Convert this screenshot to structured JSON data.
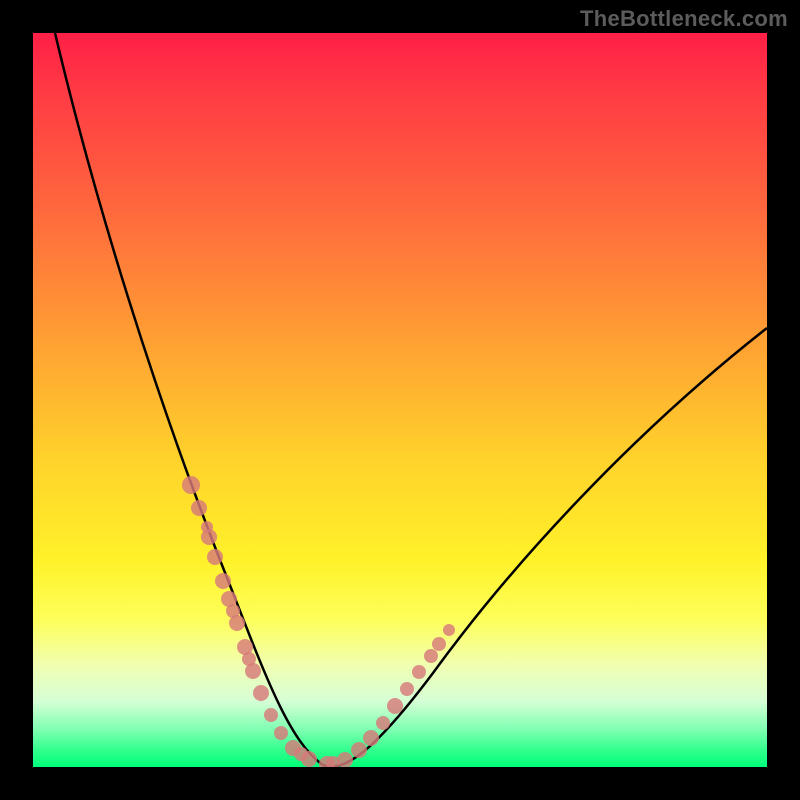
{
  "watermark_text": "TheBottleneck.com",
  "colors": {
    "background": "#000000",
    "curve": "#000000",
    "marker": "#d77a7a",
    "gradient_top": "#ff1f47",
    "gradient_bottom": "#00ff78"
  },
  "chart_data": {
    "type": "line",
    "title": "",
    "xlabel": "",
    "ylabel": "",
    "xlim": [
      0,
      100
    ],
    "ylim": [
      0,
      100
    ],
    "grid": false,
    "legend": false,
    "series": [
      {
        "name": "curve",
        "x": [
          3,
          6,
          9,
          12,
          15,
          18,
          21,
          24,
          27,
          28,
          30,
          33,
          36,
          40,
          44,
          48,
          54,
          60,
          68,
          76,
          84,
          92,
          100
        ],
        "y": [
          100,
          86,
          74,
          64,
          55,
          47,
          40,
          32,
          24,
          20,
          14,
          8,
          3,
          0,
          2,
          6,
          12,
          20,
          29,
          38,
          46,
          53,
          60
        ]
      },
      {
        "name": "markers",
        "type": "scatter",
        "x": [
          21,
          22,
          24,
          25,
          26,
          27,
          28,
          29,
          30,
          31,
          33,
          34,
          36,
          38,
          40,
          42,
          44,
          45,
          47,
          48,
          50,
          52
        ],
        "y": [
          40,
          37,
          32,
          28,
          25,
          22,
          20,
          17,
          14,
          11,
          8,
          6,
          3,
          1,
          0,
          1,
          2,
          3,
          5,
          7,
          10,
          13
        ]
      }
    ],
    "note": "Axes have no numeric labels in the source image; x/y values are normalized 0-100 estimates read visually from curve position."
  }
}
